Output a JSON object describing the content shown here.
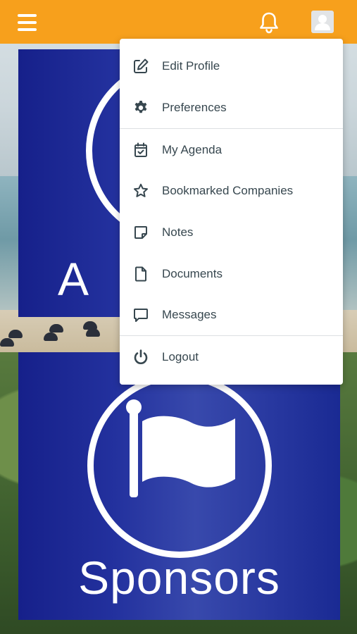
{
  "header": {
    "background": "#f7a01c",
    "menu_icon": "hamburger-icon",
    "notification_icon": "bell-icon",
    "profile_icon": "user-avatar-icon"
  },
  "tiles": {
    "top": {
      "label_partial": "A",
      "icon": "circle-icon"
    },
    "bottom": {
      "label": "Sponsors",
      "icon": "flag-icon"
    }
  },
  "menu": {
    "items": [
      {
        "label": "Edit Profile",
        "icon": "edit-icon"
      },
      {
        "label": "Preferences",
        "icon": "gear-icon"
      },
      {
        "label": "My Agenda",
        "icon": "calendar-check-icon"
      },
      {
        "label": "Bookmarked Companies",
        "icon": "star-icon"
      },
      {
        "label": "Notes",
        "icon": "note-icon"
      },
      {
        "label": "Documents",
        "icon": "document-icon"
      },
      {
        "label": "Messages",
        "icon": "message-icon"
      },
      {
        "label": "Logout",
        "icon": "power-icon"
      }
    ]
  }
}
